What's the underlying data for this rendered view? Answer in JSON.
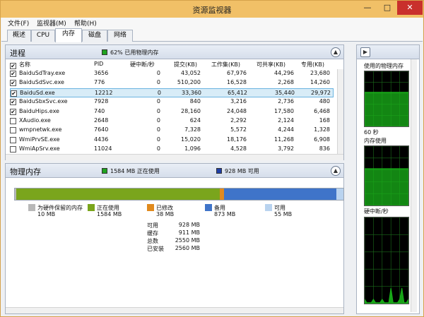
{
  "window": {
    "title": "资源监视器"
  },
  "titlebar_buttons": {
    "minimize": "—",
    "maximize": "□",
    "close": "✕"
  },
  "menu": [
    "文件(F)",
    "监视器(M)",
    "帮助(H)"
  ],
  "tabs": [
    "概述",
    "CPU",
    "内存",
    "磁盘",
    "网络"
  ],
  "process_panel": {
    "title": "进程",
    "status_color": "#1fa31f",
    "status_text": "62% 已用物理内存",
    "columns": [
      "名称",
      "PID",
      "硬中断/秒",
      "提交(KB)",
      "工作集(KB)",
      "可共享(KB)",
      "专用(KB)"
    ],
    "rows": [
      {
        "checked": "✔",
        "name": "BaiduSdTray.exe",
        "pid": "3656",
        "hard_faults": "0",
        "commit": "43,052",
        "working_set": "67,976",
        "shareable": "44,296",
        "private": "23,680"
      },
      {
        "checked": "✔",
        "name": "BaiduSdSvc.exe",
        "pid": "776",
        "hard_faults": "0",
        "commit": "510,200",
        "working_set": "16,528",
        "shareable": "2,268",
        "private": "14,260"
      },
      {
        "checked": "✔",
        "name": "BaiduSd.exe",
        "pid": "12212",
        "hard_faults": "0",
        "commit": "33,360",
        "working_set": "65,412",
        "shareable": "35,440",
        "private": "29,972"
      },
      {
        "checked": "✔",
        "name": "BaiduSbxSvc.exe",
        "pid": "7928",
        "hard_faults": "0",
        "commit": "840",
        "working_set": "3,216",
        "shareable": "2,736",
        "private": "480"
      },
      {
        "checked": "✔",
        "name": "BaiduHips.exe",
        "pid": "740",
        "hard_faults": "0",
        "commit": "28,160",
        "working_set": "24,048",
        "shareable": "17,580",
        "private": "6,468"
      },
      {
        "checked": "",
        "name": "XAudio.exe",
        "pid": "2648",
        "hard_faults": "0",
        "commit": "624",
        "working_set": "2,292",
        "shareable": "2,124",
        "private": "168"
      },
      {
        "checked": "",
        "name": "wmpnetwk.exe",
        "pid": "7640",
        "hard_faults": "0",
        "commit": "7,328",
        "working_set": "5,572",
        "shareable": "4,244",
        "private": "1,328"
      },
      {
        "checked": "",
        "name": "WmiPrvSE.exe",
        "pid": "4436",
        "hard_faults": "0",
        "commit": "15,020",
        "working_set": "18,176",
        "shareable": "11,268",
        "private": "6,908"
      },
      {
        "checked": "",
        "name": "WmiApSrv.exe",
        "pid": "11024",
        "hard_faults": "0",
        "commit": "1,096",
        "working_set": "4,528",
        "shareable": "3,792",
        "private": "836"
      }
    ]
  },
  "memory_panel": {
    "title": "物理内存",
    "in_use_color": "#1fa31f",
    "in_use_text": "1584 MB 正在使用",
    "available_color": "#1f3fa8",
    "available_text": "928 MB 可用",
    "legend": [
      {
        "label": "为硬件保留的内存",
        "value": "10 MB",
        "color": "#b8b8b8"
      },
      {
        "label": "正在使用",
        "value": "1584 MB",
        "color": "#7aa51c"
      },
      {
        "label": "已修改",
        "value": "38 MB",
        "color": "#e08a1e"
      },
      {
        "label": "备用",
        "value": "873 MB",
        "color": "#3f74c9"
      },
      {
        "label": "可用",
        "value": "55 MB",
        "color": "#b9d3ef"
      }
    ],
    "stats": [
      {
        "label": "可用",
        "value": "928 MB"
      },
      {
        "label": "缓存",
        "value": "911 MB"
      },
      {
        "label": "总数",
        "value": "2550 MB"
      },
      {
        "label": "已安装",
        "value": "2560 MB"
      }
    ]
  },
  "side_panel": {
    "graph1_label": "使用的物理内存",
    "graph1_level": 0.62,
    "time_label": "60 秒",
    "graph2_label": "内存使用",
    "graph2_level": 0.62,
    "graph3_label": "硬中断/秒",
    "graph3_level": 0.08
  },
  "colors": {
    "graph_fill": "#19b319",
    "graph_grid": "#1b6b1b"
  }
}
